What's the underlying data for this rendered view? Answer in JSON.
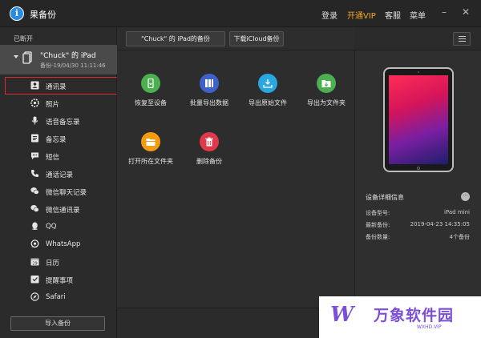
{
  "app": {
    "title": "果备份"
  },
  "top_menu": {
    "login": "登录",
    "vip": "开通VIP",
    "service": "客服",
    "menu": "菜单"
  },
  "window": {
    "minimize": "–",
    "close": "✕"
  },
  "sidebar": {
    "section_label": "已断开",
    "device": {
      "name": "\"Chuck\" 的 iPad",
      "backup_time": "备份-19/04/30 11:11:46"
    },
    "items": [
      {
        "label": "通讯录",
        "icon": "contacts-icon"
      },
      {
        "label": "照片",
        "icon": "photos-icon"
      },
      {
        "label": "语音备忘录",
        "icon": "microphone-icon"
      },
      {
        "label": "备忘录",
        "icon": "notes-icon"
      },
      {
        "label": "短信",
        "icon": "message-icon"
      },
      {
        "label": "通话记录",
        "icon": "phone-icon"
      },
      {
        "label": "微信聊天记录",
        "icon": "wechat-icon"
      },
      {
        "label": "微信通讯录",
        "icon": "wechat-contacts-icon"
      },
      {
        "label": "QQ",
        "icon": "qq-icon"
      },
      {
        "label": "WhatsApp",
        "icon": "whatsapp-icon"
      },
      {
        "label": "日历",
        "icon": "calendar-icon"
      },
      {
        "label": "提醒事项",
        "icon": "reminder-icon"
      },
      {
        "label": "Safari",
        "icon": "safari-icon"
      }
    ],
    "import_button": "导入备份"
  },
  "tabs": {
    "backup_tab": "\"Chuck\" 的 iPad的备份",
    "icloud_tab": "下载iCloud备份"
  },
  "actions": [
    {
      "label": "恢复至设备",
      "color": "#4caf50",
      "icon": "restore-device-icon"
    },
    {
      "label": "批量导出数据",
      "color": "#3f62c9",
      "icon": "batch-export-icon"
    },
    {
      "label": "导出原始文件",
      "color": "#2aa7e0",
      "icon": "export-raw-icon"
    },
    {
      "label": "导出为文件夹",
      "color": "#4caf50",
      "icon": "export-folder-icon"
    },
    {
      "label": "打开所在文件夹",
      "color": "#f39c12",
      "icon": "open-folder-icon"
    },
    {
      "label": "删除备份",
      "color": "#e0394a",
      "icon": "delete-backup-icon"
    }
  ],
  "device_details": {
    "title": "设备详细信息",
    "rows": [
      {
        "key": "设备型号:",
        "value": "iPad mini"
      },
      {
        "key": "最新备份:",
        "value": "2019-04-23 14:35:05"
      },
      {
        "key": "备份数量:",
        "value": "4个备份"
      }
    ]
  },
  "watermark": {
    "logo": "W",
    "text": "万象软件园",
    "url": "WXHD.VIP"
  },
  "colors": {
    "accent_vip": "#f5a623",
    "highlight": "#e02a2a",
    "brand": "#2a8ce0"
  }
}
